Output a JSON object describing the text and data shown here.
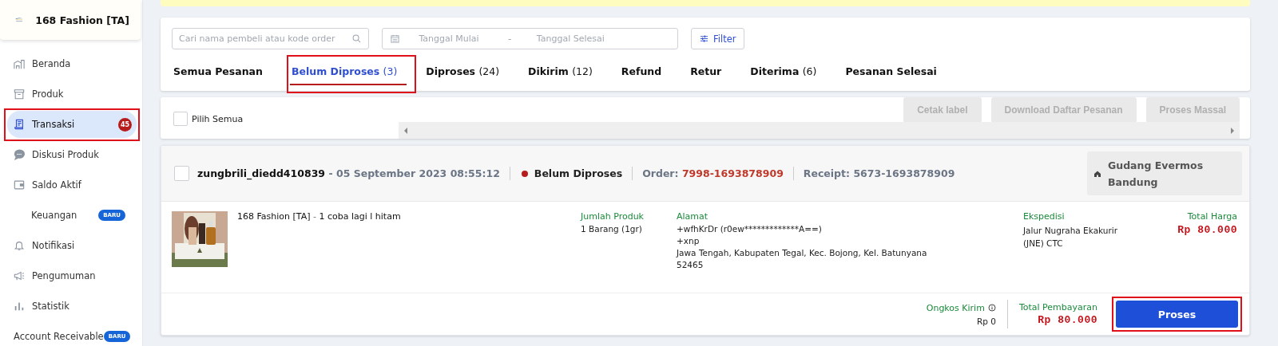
{
  "store": {
    "name": "168 Fashion [TA]"
  },
  "nav": [
    {
      "label": "Beranda",
      "kind": "home",
      "selected": false,
      "highlighted": false
    },
    {
      "label": "Produk",
      "kind": "box",
      "selected": false,
      "highlighted": false
    },
    {
      "label": "Transaksi",
      "kind": "receipt",
      "selected": true,
      "highlighted": true,
      "count": "45"
    },
    {
      "label": "Diskusi Produk",
      "kind": "chat",
      "selected": false,
      "highlighted": false
    },
    {
      "label": "Saldo Aktif",
      "kind": "wallet",
      "selected": false,
      "highlighted": false
    },
    {
      "label": "Keuangan",
      "kind": "sub",
      "selected": false,
      "highlighted": false,
      "badge": "BARU"
    },
    {
      "label": "Notifikasi",
      "kind": "bell",
      "selected": false,
      "highlighted": false
    },
    {
      "label": "Pengumuman",
      "kind": "megaphone",
      "selected": false,
      "highlighted": false
    },
    {
      "label": "Statistik",
      "kind": "chart",
      "selected": false,
      "highlighted": false
    },
    {
      "label": "Account Receivable",
      "kind": "plain",
      "selected": false,
      "highlighted": false,
      "badge": "BARU"
    }
  ],
  "search": {
    "placeholder": "Cari nama pembeli atau kode order"
  },
  "date_range": {
    "start_placeholder": "Tanggal Mulai",
    "separator": "-",
    "end_placeholder": "Tanggal Selesai"
  },
  "filter_button": "Filter",
  "tabs": [
    {
      "label": "Semua Pesanan",
      "selected": false,
      "highlighted": false
    },
    {
      "label": "Belum Diproses",
      "count": "(3)",
      "selected": true,
      "highlighted": true
    },
    {
      "label": "Diproses",
      "count": "(24)",
      "selected": false,
      "highlighted": false
    },
    {
      "label": "Dikirim",
      "count": "(12)",
      "selected": false,
      "highlighted": false
    },
    {
      "label": "Refund",
      "selected": false,
      "highlighted": false
    },
    {
      "label": "Retur",
      "selected": false,
      "highlighted": false
    },
    {
      "label": "Diterima",
      "count": "(6)",
      "selected": false,
      "highlighted": false
    },
    {
      "label": "Pesanan Selesai",
      "selected": false,
      "highlighted": false
    }
  ],
  "select_all": {
    "label": "Pilih Semua",
    "checked": false
  },
  "bulk_actions": [
    {
      "label": "Cetak label",
      "disabled": true
    },
    {
      "label": "Download Daftar Pesanan",
      "disabled": true
    },
    {
      "label": "Proses Massal",
      "disabled": true
    }
  ],
  "order": {
    "checked": false,
    "buyer": "zungbrili_diedd410839",
    "date": "- 05 September 2023 08:55:12",
    "status": "Belum Diproses",
    "order_label": "Order:",
    "order_no": "7998-1693878909",
    "receipt": "Receipt: 5673-1693878909",
    "warehouse": "Gudang Evermos Bandung",
    "product": {
      "store": "168 Fashion [TA]",
      "sep": "-",
      "name": "1 coba lagi l hitam"
    },
    "quantity_label": "Jumlah Produk",
    "quantity": "1 Barang (1gr)",
    "address_label": "Alamat",
    "address_lines": [
      "+wfhKrDr (r0ew*************A==)",
      "+xnp",
      "Jawa Tengah, Kabupaten Tegal, Kec. Bojong, Kel. Batunyana",
      "52465"
    ],
    "courier_label": "Ekspedisi",
    "courier": "Jalur Nugraha Ekakurir (JNE) CTC",
    "total_price_label": "Total Harga",
    "total_price": "Rp 80.000",
    "shipping_label": "Ongkos Kirim",
    "shipping": "Rp 0",
    "total_payment_label": "Total Pembayaran",
    "total_payment": "Rp 80.000",
    "process_button": {
      "label": "Proses",
      "highlighted": true
    }
  }
}
